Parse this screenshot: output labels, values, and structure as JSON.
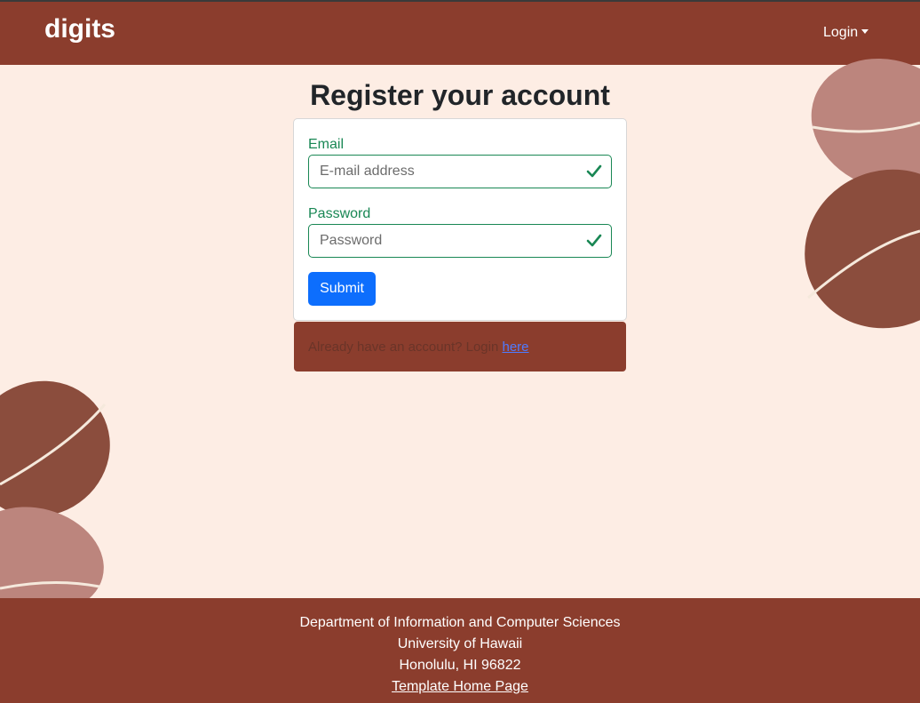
{
  "navbar": {
    "brand": "digits",
    "login_label": "Login"
  },
  "form": {
    "title": "Register your account",
    "email_label": "Email",
    "email_placeholder": "E-mail address",
    "password_label": "Password",
    "password_placeholder": "Password",
    "submit_label": "Submit"
  },
  "login_prompt": {
    "text": "Already have an account? Login ",
    "link": "here"
  },
  "footer": {
    "line1": "Department of Information and Computer Sciences",
    "line2": "University of Hawaii",
    "line3": "Honolulu, HI 96822",
    "link": "Template Home Page"
  },
  "colors": {
    "brand": "#8b3d2d",
    "background": "#fdede4",
    "valid": "#198754",
    "primary": "#0d6efd"
  },
  "icons": [
    "check-icon",
    "caret-down-icon"
  ]
}
